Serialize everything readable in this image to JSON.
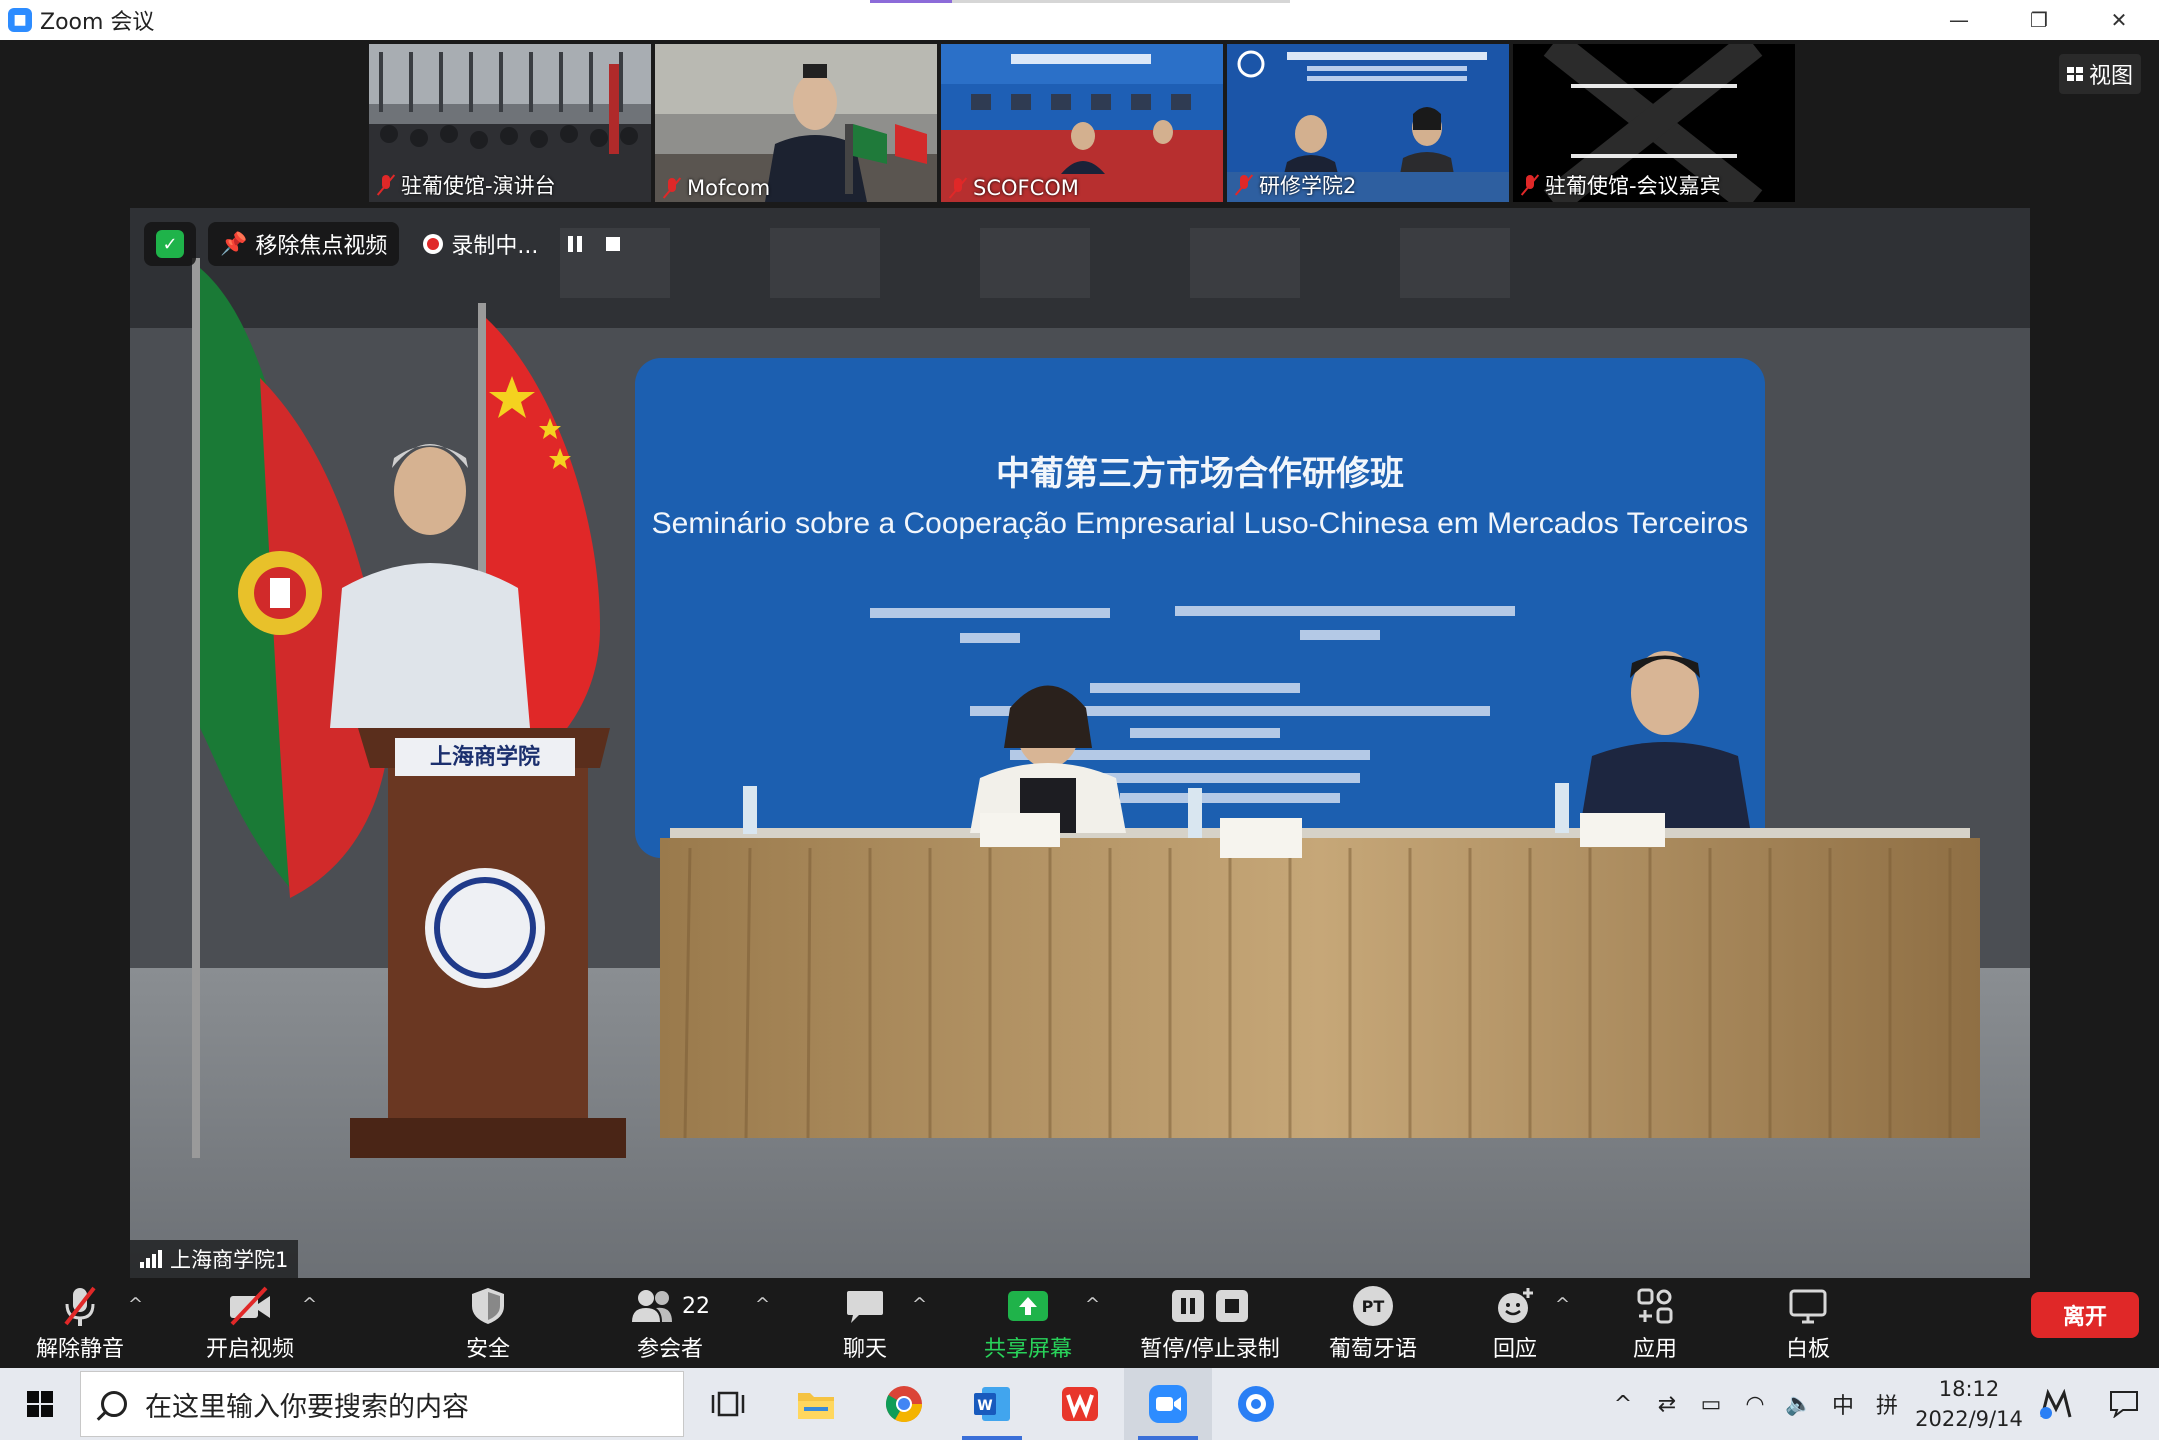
{
  "window": {
    "title": "Zoom 会议",
    "controls": [
      "minimize",
      "restore",
      "close"
    ]
  },
  "thumbnails": [
    {
      "label": "驻葡使馆-演讲台",
      "muted": true
    },
    {
      "label": "Mofcom",
      "muted": true
    },
    {
      "label": "SCOFCOM",
      "muted": true
    },
    {
      "label": "研修学院2",
      "muted": true
    },
    {
      "label": "驻葡使馆-会议嘉宾",
      "muted": true
    }
  ],
  "view_button": {
    "label": "视图"
  },
  "video_toolbar": {
    "unpin_label": "移除焦点视频",
    "recording_label": "录制中..."
  },
  "main_video": {
    "speaker_name": "上海商学院1",
    "banner_title_cn": "中葡第三方市场合作研修班",
    "banner_title_pt": "Seminário sobre a Cooperação Empresarial Luso-Chinesa em Mercados Terceiros",
    "podium_text": "上海商学院"
  },
  "toolbar": {
    "unmute": "解除静音",
    "start_video": "开启视频",
    "security": "安全",
    "participants": "参会者",
    "participants_count": "22",
    "chat": "聊天",
    "share_screen": "共享屏幕",
    "record": "暂停/停止录制",
    "language": "葡萄牙语",
    "language_badge": "PT",
    "reactions": "回应",
    "apps": "应用",
    "whiteboard": "白板",
    "leave": "离开"
  },
  "taskbar": {
    "search_placeholder": "在这里输入你要搜索的内容",
    "ime_mode": "中",
    "ime_layout": "拼",
    "time": "18:12",
    "date": "2022/9/14"
  },
  "colors": {
    "zoom_blue": "#2d8cff",
    "danger_red": "#e02828",
    "share_green": "#1fb34a",
    "banner_blue": "#1c5fb0"
  }
}
